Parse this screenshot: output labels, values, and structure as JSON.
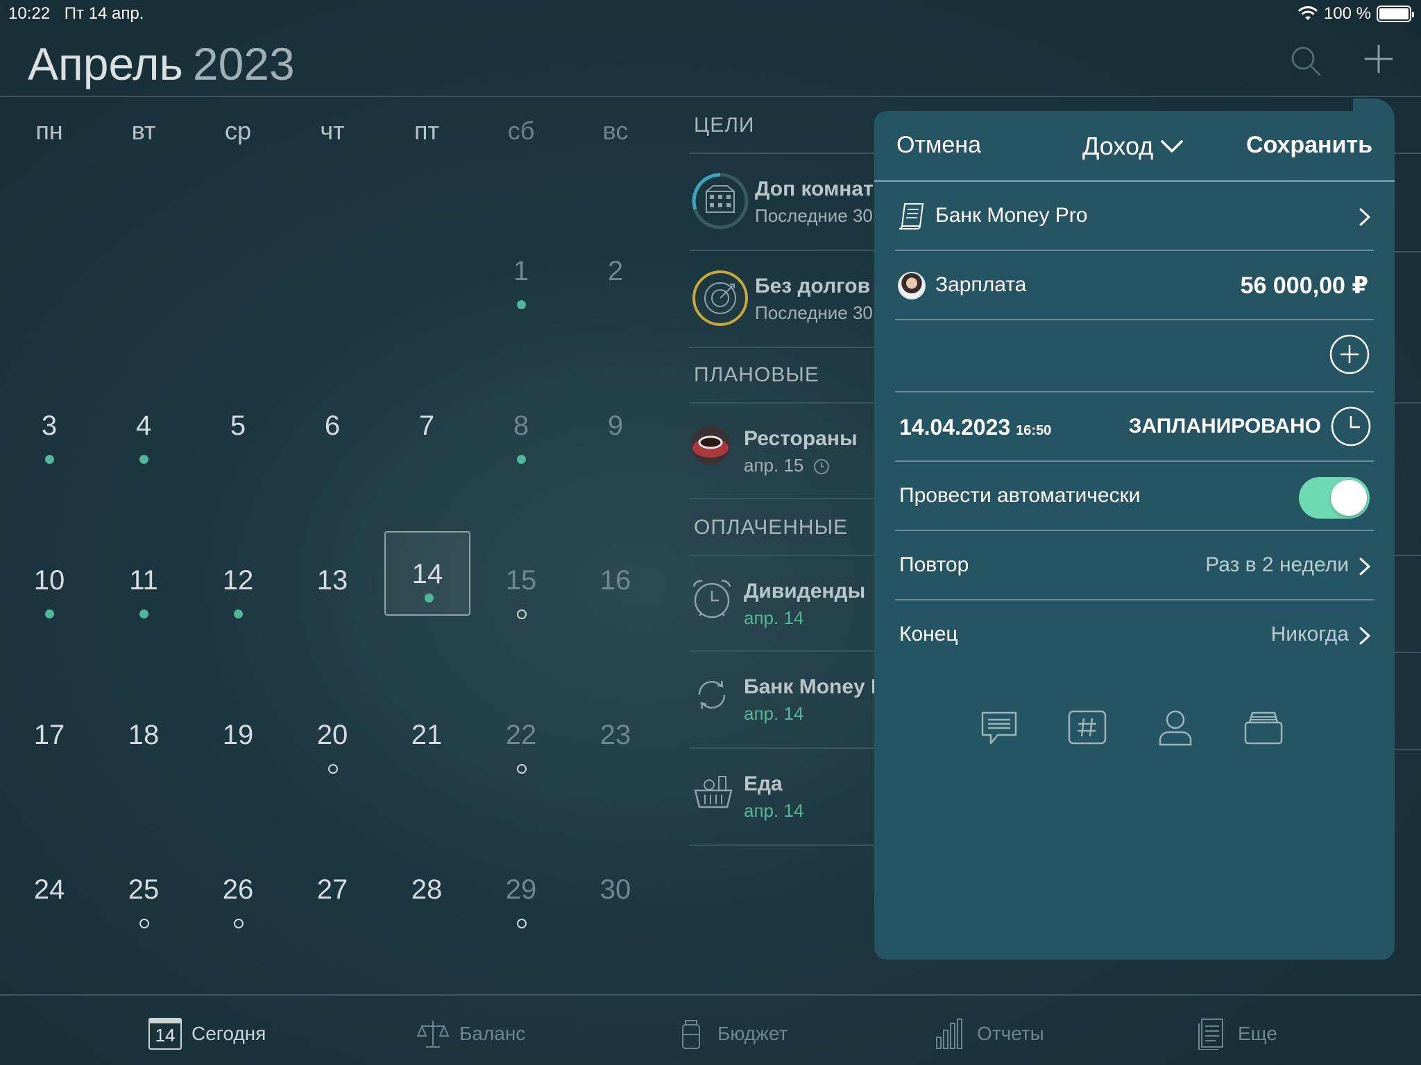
{
  "status": {
    "time": "10:22",
    "date": "Пт 14 апр.",
    "battery": "100 %"
  },
  "header": {
    "month": "Апрель",
    "year": "2023"
  },
  "calendar": {
    "weekdays": [
      "пн",
      "вт",
      "ср",
      "чт",
      "пт",
      "сб",
      "вс"
    ],
    "days": [
      "1",
      "2",
      "3",
      "4",
      "5",
      "6",
      "7",
      "8",
      "9",
      "10",
      "11",
      "12",
      "13",
      "14",
      "15",
      "16",
      "17",
      "18",
      "19",
      "20",
      "21",
      "22",
      "23",
      "24",
      "25",
      "26",
      "27",
      "28",
      "29",
      "30"
    ],
    "today": "14"
  },
  "list": {
    "sections": [
      "ЦЕЛИ",
      "ПЛАНОВЫЕ",
      "ОПЛАЧЕННЫЕ"
    ],
    "goals": [
      {
        "title": "Доп комнат",
        "sub": "Последние 30"
      },
      {
        "title": "Без долгов",
        "sub": "Последние 30"
      }
    ],
    "planned": [
      {
        "title": "Рестораны",
        "sub": "апр. 15"
      }
    ],
    "paid": [
      {
        "title": "Дивиденды",
        "sub": "апр. 14"
      },
      {
        "title": "Банк Money I",
        "sub": "апр. 14"
      },
      {
        "title": "Еда",
        "sub": "апр. 14"
      }
    ]
  },
  "modal": {
    "cancel": "Отмена",
    "type": "Доход",
    "save": "Сохранить",
    "account": "Банк Money Pro",
    "category": "Зарплата",
    "amount": "56 000,00 ₽",
    "date": "14.04.2023",
    "time": "16:50",
    "status": "ЗАПЛАНИРОВАНО",
    "auto_label": "Провести автоматически",
    "auto_on": true,
    "repeat_label": "Повтор",
    "repeat_value": "Раз в 2 недели",
    "end_label": "Конец",
    "end_value": "Никогда"
  },
  "tabs": [
    {
      "label": "Сегодня",
      "icon": "calendar-icon",
      "badge": "14"
    },
    {
      "label": "Баланс",
      "icon": "scales-icon"
    },
    {
      "label": "Бюджет",
      "icon": "jar-icon"
    },
    {
      "label": "Отчеты",
      "icon": "bar-chart-icon"
    },
    {
      "label": "Еще",
      "icon": "document-icon"
    }
  ],
  "colors": {
    "accent": "#4fb89a",
    "modal_bg": "#255562",
    "toggle": "#6fd9b2"
  }
}
